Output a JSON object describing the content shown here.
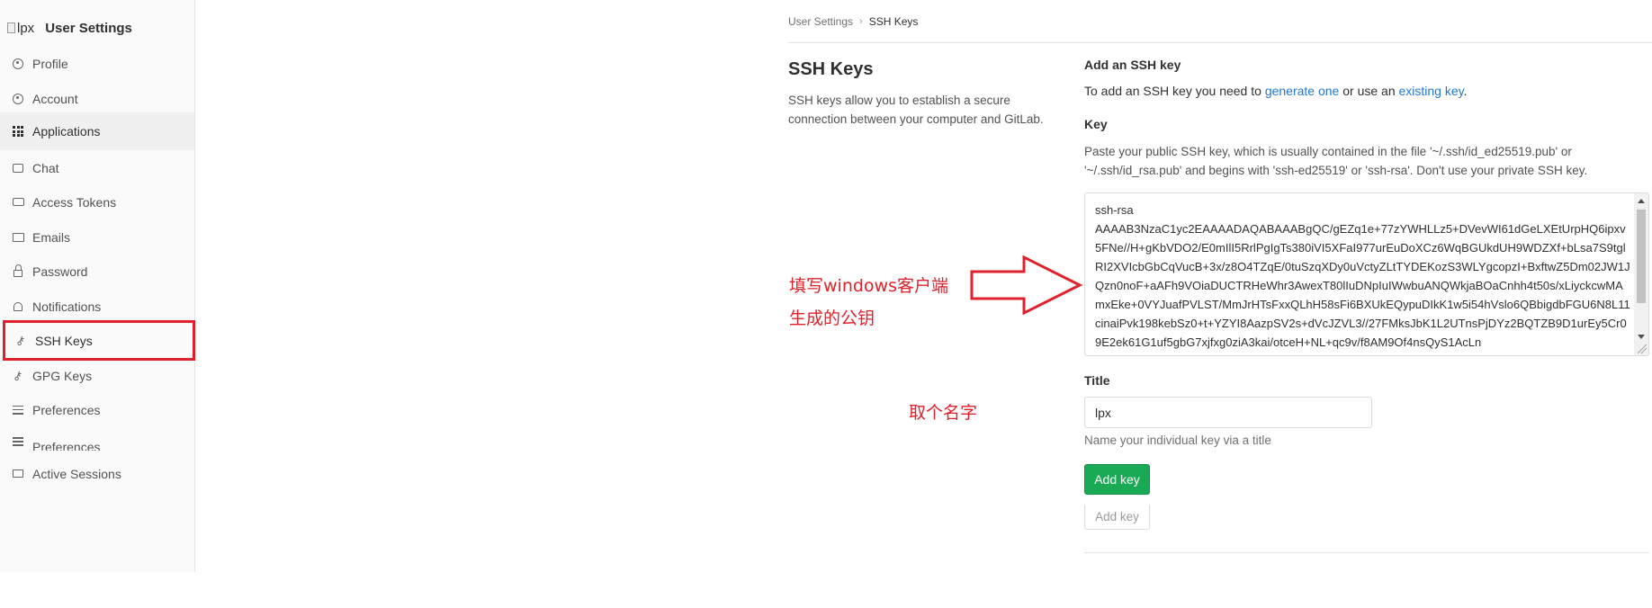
{
  "sidebar": {
    "logo_alt": "lpx",
    "title": "User Settings",
    "items": [
      {
        "label": "Profile",
        "icon": "profile-icon"
      },
      {
        "label": "Account",
        "icon": "account-icon"
      },
      {
        "label": "Applications",
        "icon": "applications-icon"
      },
      {
        "label": "Chat",
        "icon": "chat-icon"
      },
      {
        "label": "Access Tokens",
        "icon": "token-icon"
      },
      {
        "label": "Emails",
        "icon": "mail-icon"
      },
      {
        "label": "Password",
        "icon": "lock-icon"
      },
      {
        "label": "Notifications",
        "icon": "bell-icon"
      },
      {
        "label": "SSH Keys",
        "icon": "key-icon"
      },
      {
        "label": "GPG Keys",
        "icon": "key-icon"
      },
      {
        "label": "Preferences",
        "icon": "sliders-icon"
      },
      {
        "label": "Preferences",
        "icon": "sliders-icon"
      },
      {
        "label": "Active Sessions",
        "icon": "monitor-icon"
      }
    ]
  },
  "breadcrumb": {
    "parent": "User Settings",
    "separator": "›",
    "current": "SSH Keys"
  },
  "page": {
    "title": "SSH Keys",
    "description": "SSH keys allow you to establish a secure connection between your computer and GitLab."
  },
  "add_form": {
    "heading": "Add an SSH key",
    "intro_prefix": "To add an SSH key you need to ",
    "generate_link": "generate one",
    "intro_middle": " or use an ",
    "existing_link": "existing key",
    "intro_suffix": ".",
    "key_label": "Key",
    "key_help": "Paste your public SSH key, which is usually contained in the file '~/.ssh/id_ed25519.pub' or '~/.ssh/id_rsa.pub' and begins with 'ssh-ed25519' or 'ssh-rsa'. Don't use your private SSH key.",
    "key_value": "ssh-rsa\nAAAAB3NzaC1yc2EAAAADAQABAAABgQC/gEZq1e+77zYWHLLz5+DVevWI61dGeLXEtUrpHQ6ipxv5FNe//H+gKbVDO2/E0mIlI5RrlPgIgTs380iVI5XFaI977urEuDoXCz6WqBGUkdUH9WDZXf+bLsa7S9tglRI2XVIcbGbCqVucB+3x/z8O4TZqE/0tuSzqXDy0uVctyZLtTYDEKozS3WLYgcopzI+BxftwZ5Dm02JW1JQzn0noF+aAFh9VOiaDUCTRHeWhr3AwexT80lIuDNpIuIWwbuANQWkjaBOaCnhh4t50s/xLiyckcwMAmxEke+0VYJuafPVLST/MmJrHTsFxxQLhH58sFi6BXUkEQypuDIkK1w5i54hVslo6QBbigdbFGU6N8L11cinaiPvk198kebSz0+t+YZYI8AazpSV2s+dVcJZVL3//27FMksJbK1L2UTnsPjDYz2BQTZB9D1urEy5Cr09E2ek61G1uf5gbG7xjfxg0ziA3kai/otceH+NL+qc9v/f8AM9Of4nsQyS1AcLn",
    "title_label": "Title",
    "title_value": "lpx",
    "title_help": "Name your individual key via a title",
    "submit_label": "Add key",
    "ghost_label": "Add key"
  },
  "annotations": {
    "arrow_note_line1": "填写windows客户端",
    "arrow_note_line2": "生成的公钥",
    "title_note": "取个名字",
    "color": "#e0202b"
  },
  "colors": {
    "primary_button": "#1aaa55",
    "link": "#1f78d1",
    "highlight": "#e0202b"
  }
}
